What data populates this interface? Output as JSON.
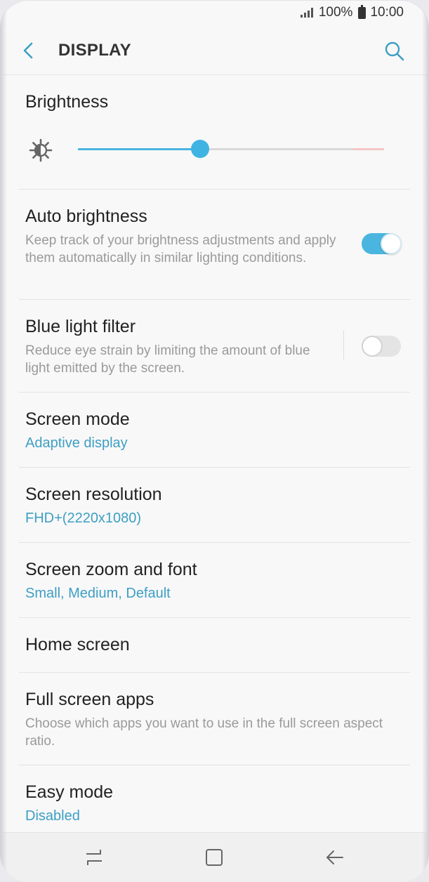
{
  "status_bar": {
    "battery_percent": "100%",
    "time": "10:00",
    "icons": [
      "signal-icon",
      "battery-icon"
    ]
  },
  "header": {
    "title": "DISPLAY",
    "back_icon": "back-arrow-icon",
    "search_icon": "search-icon"
  },
  "brightness": {
    "title": "Brightness",
    "icon": "brightness-sun-icon",
    "level": 0.4,
    "colors": {
      "accent": "#4ab6df",
      "track": "#d9d9d9",
      "high_end": "#f5c6c6"
    }
  },
  "settings": {
    "auto_brightness": {
      "title": "Auto brightness",
      "description": "Keep track of your brightness adjustments and apply them automatically in similar lighting conditions.",
      "enabled": true
    },
    "blue_light_filter": {
      "title": "Blue light filter",
      "description": "Reduce eye strain by limiting the amount of blue light emitted by the screen.",
      "enabled": false
    },
    "screen_mode": {
      "title": "Screen mode",
      "value": "Adaptive display"
    },
    "screen_resolution": {
      "title": "Screen resolution",
      "value": "FHD+(2220x1080)"
    },
    "screen_zoom_font": {
      "title": "Screen zoom and font",
      "value": "Small, Medium, Default"
    },
    "home_screen": {
      "title": "Home screen"
    },
    "full_screen_apps": {
      "title": "Full screen apps",
      "description": "Choose which apps you want to use in the full screen aspect ratio."
    },
    "easy_mode": {
      "title": "Easy mode",
      "value": "Disabled"
    }
  },
  "nav_bar": {
    "buttons": [
      "recent-apps-icon",
      "home-icon",
      "back-icon"
    ]
  },
  "colors": {
    "accent": "#4ab6df",
    "value_text": "#3d9fc4",
    "secondary_text": "#9a9a9a",
    "primary_text": "#222222"
  }
}
